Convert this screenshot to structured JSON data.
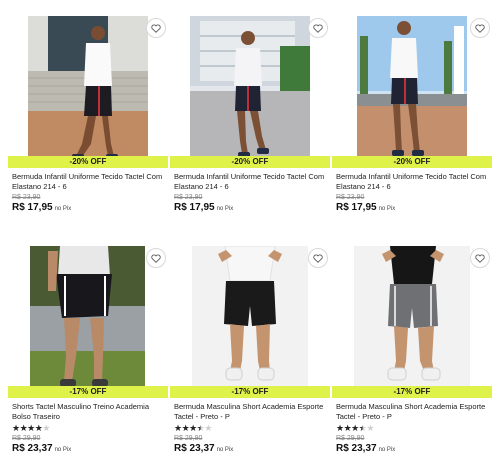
{
  "products": [
    {
      "title": "Bermuda Infantil Uniforme Tecido Tactel Com Elastano 214 - 6",
      "discount": "-20% OFF",
      "old_price": "R$ 23,90",
      "price": "R$ 17,95",
      "pix": "no Pix",
      "rating": null
    },
    {
      "title": "Bermuda Infantil Uniforme Tecido Tactel Com Elastano 214 - 6",
      "discount": "-20% OFF",
      "old_price": "R$ 23,90",
      "price": "R$ 17,95",
      "pix": "no Pix",
      "rating": null
    },
    {
      "title": "Bermuda Infantil Uniforme Tecido Tactel Com Elastano 214 - 6",
      "discount": "-20% OFF",
      "old_price": "R$ 23,90",
      "price": "R$ 17,95",
      "pix": "no Pix",
      "rating": null
    },
    {
      "title": "Shorts Tactel Masculino Treino Academia Bolso Traseiro",
      "discount": "-17% OFF",
      "old_price": "R$ 29,90",
      "price": "R$ 23,37",
      "pix": "no Pix",
      "rating": 4
    },
    {
      "title": "Bermuda Masculina Short Academia Esporte Tactel - Preto - P",
      "discount": "-17% OFF",
      "old_price": "R$ 29,90",
      "price": "R$ 23,37",
      "pix": "no Pix",
      "rating": 3.5
    },
    {
      "title": "Bermuda Masculina Short Academia Esporte Tactel - Preto - P",
      "discount": "-17% OFF",
      "old_price": "R$ 29,90",
      "price": "R$ 23,37",
      "pix": "no Pix",
      "rating": 3.5
    }
  ],
  "icons": {
    "favorite": "heart-outline-icon",
    "rating": "star-icon"
  },
  "colors": {
    "discount_badge": "#dff24a",
    "price": "#111111",
    "old_price": "#888888"
  }
}
